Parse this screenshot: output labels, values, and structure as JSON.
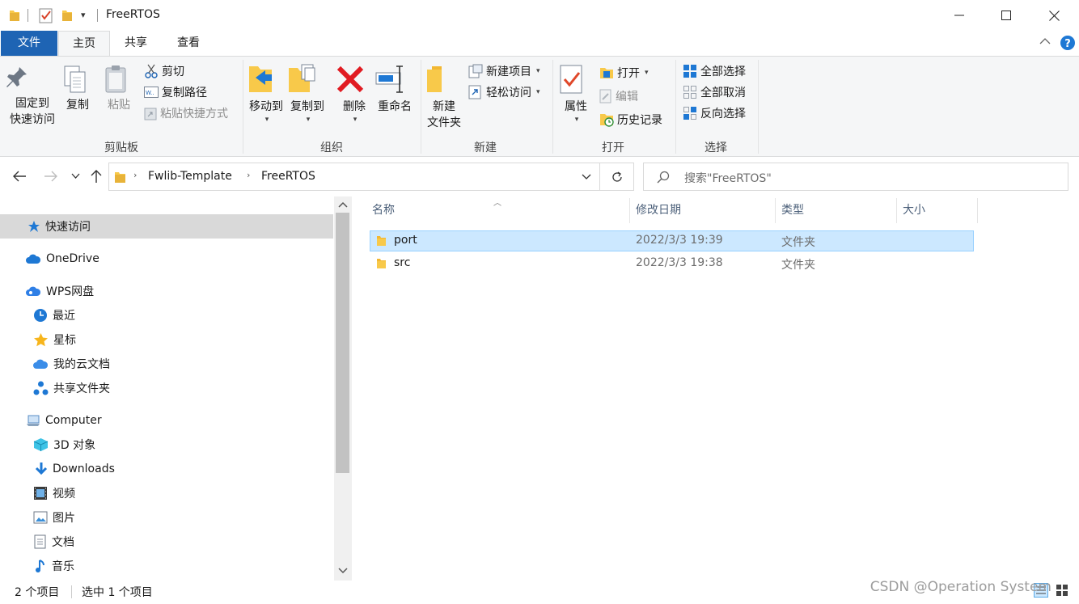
{
  "window": {
    "title": "FreeRTOS"
  },
  "ribbon_tabs": [
    "文件",
    "主页",
    "共享",
    "查看"
  ],
  "ribbon": {
    "clipboard": {
      "label": "剪贴板",
      "pin_line1": "固定到",
      "pin_line2": "快速访问",
      "copy": "复制",
      "paste": "粘贴",
      "cut": "剪切",
      "copy_path": "复制路径",
      "paste_shortcut": "粘贴快捷方式"
    },
    "organize": {
      "label": "组织",
      "move_to": "移动到",
      "copy_to": "复制到",
      "delete": "删除",
      "rename": "重命名"
    },
    "new": {
      "label": "新建",
      "new_folder_line1": "新建",
      "new_folder_line2": "文件夹",
      "new_item": "新建项目",
      "easy_access": "轻松访问"
    },
    "open": {
      "label": "打开",
      "properties": "属性",
      "open": "打开",
      "edit": "编辑",
      "history": "历史记录"
    },
    "select": {
      "label": "选择",
      "select_all": "全部选择",
      "select_none": "全部取消",
      "invert": "反向选择"
    }
  },
  "address": {
    "crumbs": [
      "Fwlib-Template",
      "FreeRTOS"
    ],
    "search_placeholder": "搜索\"FreeRTOS\""
  },
  "nav": {
    "quick_access": "快速访问",
    "onedrive": "OneDrive",
    "wps": "WPS网盘",
    "recent": "最近",
    "starred": "星标",
    "my_cloud_docs": "我的云文档",
    "shared_folder": "共享文件夹",
    "computer": "Computer",
    "objects_3d": "3D 对象",
    "downloads": "Downloads",
    "videos": "视频",
    "pictures": "图片",
    "documents": "文档",
    "music": "音乐"
  },
  "columns": {
    "name": "名称",
    "modified": "修改日期",
    "type": "类型",
    "size": "大小"
  },
  "files": [
    {
      "name": "port",
      "modified": "2022/3/3 19:39",
      "type": "文件夹"
    },
    {
      "name": "src",
      "modified": "2022/3/3 19:38",
      "type": "文件夹"
    }
  ],
  "status": {
    "count": "2 个项目",
    "selected": "选中 1 个项目"
  },
  "watermark": "CSDN @Operation System",
  "colors": {
    "accent": "#1e64b4",
    "selection": "#cce8ff",
    "folder": "#f8c94a"
  }
}
